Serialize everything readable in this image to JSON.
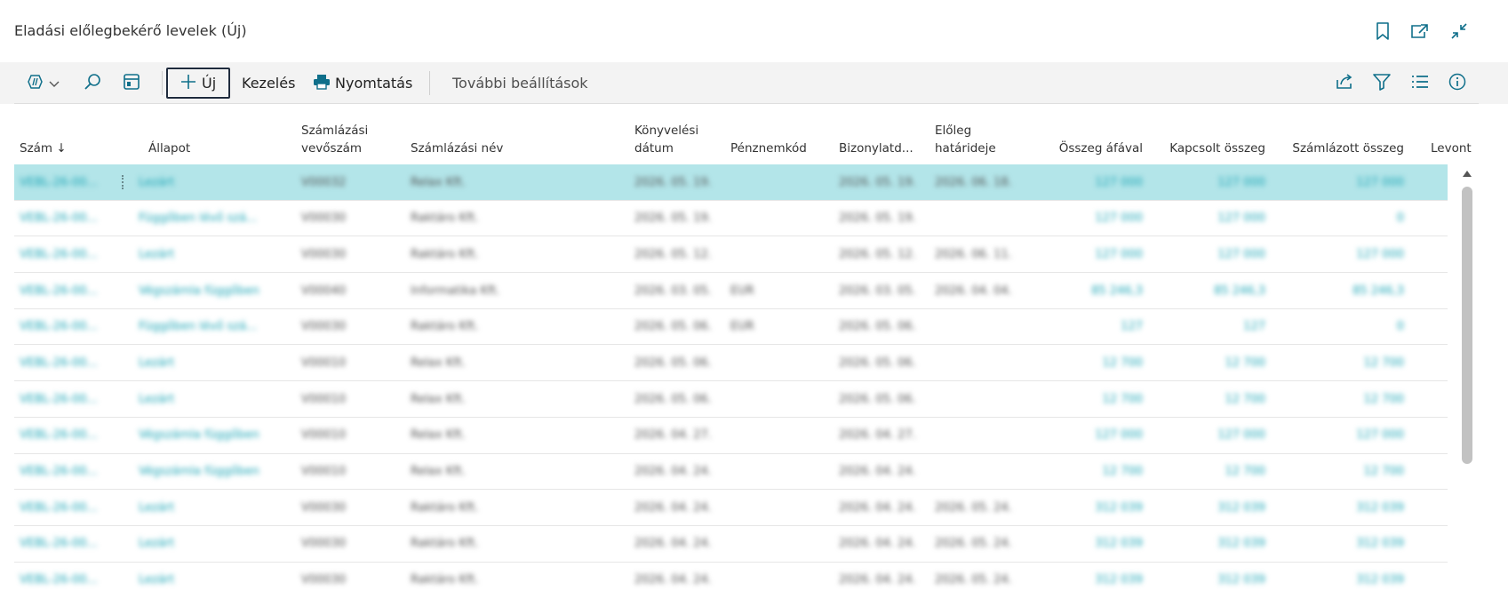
{
  "header": {
    "title": "Eladási előlegbekérő levelek (Új)",
    "icons": [
      "bookmark-icon",
      "open-new-window-icon",
      "collapse-icon"
    ]
  },
  "actionbar": {
    "new_label": "Új",
    "manage_label": "Kezelés",
    "print_label": "Nyomtatás",
    "more_label": "További beállítások",
    "left_icons": [
      "copilot-icon",
      "search-icon",
      "layout-icon"
    ],
    "right_icons": [
      "share-icon",
      "filter-icon",
      "list-view-icon",
      "info-icon"
    ]
  },
  "grid": {
    "columns": [
      {
        "key": "szam",
        "label": "Szám ↓"
      },
      {
        "key": "allapot",
        "label": "Állapot"
      },
      {
        "key": "vevoszam",
        "label": "Számlázási\nvevőszám"
      },
      {
        "key": "nev",
        "label": "Számlázási név"
      },
      {
        "key": "datum",
        "label": "Könyvelési\ndátum"
      },
      {
        "key": "penznem",
        "label": "Pénznemkód"
      },
      {
        "key": "bizonylat",
        "label": "Bizonylatd..."
      },
      {
        "key": "hatarido",
        "label": "Előleg\nhatárideje"
      },
      {
        "key": "osszeg",
        "label": "Összeg áfával"
      },
      {
        "key": "kapcsolt",
        "label": "Kapcsolt összeg"
      },
      {
        "key": "szamlazott",
        "label": "Számlázott összeg"
      },
      {
        "key": "levont",
        "label": "Levont"
      }
    ],
    "rows": [
      {
        "szam": "VEBL-26-00...",
        "allapot": "Lezárt",
        "vevoszam": "V00032",
        "nev": "Relax Kft.",
        "datum": "2026. 05. 19.",
        "penznem": "",
        "bizonylat": "2026. 05. 19.",
        "hatarido": "2026. 06. 18.",
        "osszeg": "127 000",
        "kapcsolt": "127 000",
        "szamlazott": "127 000",
        "selected": true
      },
      {
        "szam": "VEBL-26-00...",
        "allapot": "Függőben lévő szá...",
        "vevoszam": "V00030",
        "nev": "Raktáro Kft.",
        "datum": "2026. 05. 19.",
        "penznem": "",
        "bizonylat": "2026. 05. 19.",
        "hatarido": "",
        "osszeg": "127 000",
        "kapcsolt": "127 000",
        "szamlazott": "0"
      },
      {
        "szam": "VEBL-26-00...",
        "allapot": "Lezárt",
        "vevoszam": "V00030",
        "nev": "Raktáro Kft.",
        "datum": "2026. 05. 12.",
        "penznem": "",
        "bizonylat": "2026. 05. 12.",
        "hatarido": "2026. 06. 11.",
        "osszeg": "127 000",
        "kapcsolt": "127 000",
        "szamlazott": "127 000"
      },
      {
        "szam": "VEBL-26-00...",
        "allapot": "Végszámla függőben",
        "vevoszam": "V00040",
        "nev": "Informatika Kft.",
        "datum": "2026. 03. 05.",
        "penznem": "EUR",
        "bizonylat": "2026. 03. 05.",
        "hatarido": "2026. 04. 04.",
        "osszeg": "85 246,3",
        "kapcsolt": "85 246,3",
        "szamlazott": "85 246,3"
      },
      {
        "szam": "VEBL-26-00...",
        "allapot": "Függőben lévő szá...",
        "vevoszam": "V00030",
        "nev": "Raktáro Kft.",
        "datum": "2026. 05. 06.",
        "penznem": "EUR",
        "bizonylat": "2026. 05. 06.",
        "hatarido": "",
        "osszeg": "127",
        "kapcsolt": "127",
        "szamlazott": "0"
      },
      {
        "szam": "VEBL-26-00...",
        "allapot": "Lezárt",
        "vevoszam": "V00010",
        "nev": "Relax Kft.",
        "datum": "2026. 05. 06.",
        "penznem": "",
        "bizonylat": "2026. 05. 06.",
        "hatarido": "",
        "osszeg": "12 700",
        "kapcsolt": "12 700",
        "szamlazott": "12 700"
      },
      {
        "szam": "VEBL-26-00...",
        "allapot": "Lezárt",
        "vevoszam": "V00010",
        "nev": "Relax Kft.",
        "datum": "2026. 05. 06.",
        "penznem": "",
        "bizonylat": "2026. 05. 06.",
        "hatarido": "",
        "osszeg": "12 700",
        "kapcsolt": "12 700",
        "szamlazott": "12 700"
      },
      {
        "szam": "VEBL-26-00...",
        "allapot": "Végszámla függőben",
        "vevoszam": "V00010",
        "nev": "Relax Kft.",
        "datum": "2026. 04. 27.",
        "penznem": "",
        "bizonylat": "2026. 04. 27.",
        "hatarido": "",
        "osszeg": "127 000",
        "kapcsolt": "127 000",
        "szamlazott": "127 000"
      },
      {
        "szam": "VEBL-26-00...",
        "allapot": "Végszámla függőben",
        "vevoszam": "V00010",
        "nev": "Relax Kft.",
        "datum": "2026. 04. 24.",
        "penznem": "",
        "bizonylat": "2026. 04. 24.",
        "hatarido": "",
        "osszeg": "12 700",
        "kapcsolt": "12 700",
        "szamlazott": "12 700"
      },
      {
        "szam": "VEBL-26-00...",
        "allapot": "Lezárt",
        "vevoszam": "V00030",
        "nev": "Raktáro Kft.",
        "datum": "2026. 04. 24.",
        "penznem": "",
        "bizonylat": "2026. 04. 24.",
        "hatarido": "2026. 05. 24.",
        "osszeg": "312 039",
        "kapcsolt": "312 039",
        "szamlazott": "312 039"
      },
      {
        "szam": "VEBL-26-00...",
        "allapot": "Lezárt",
        "vevoszam": "V00030",
        "nev": "Raktáro Kft.",
        "datum": "2026. 04. 24.",
        "penznem": "",
        "bizonylat": "2026. 04. 24.",
        "hatarido": "2026. 05. 24.",
        "osszeg": "312 039",
        "kapcsolt": "312 039",
        "szamlazott": "312 039"
      },
      {
        "szam": "VEBL-26-00...",
        "allapot": "Lezárt",
        "vevoszam": "V00030",
        "nev": "Raktáro Kft.",
        "datum": "2026. 04. 24.",
        "penznem": "",
        "bizonylat": "2026. 04. 24.",
        "hatarido": "2026. 05. 24.",
        "osszeg": "312 039",
        "kapcsolt": "312 039",
        "szamlazott": "312 039"
      }
    ]
  },
  "colors": {
    "accent": "#16a3b4",
    "selected_row": "#b3e5e9",
    "header_icon": "#0f6f8a",
    "actionbar_bg": "#f3f3f3"
  }
}
